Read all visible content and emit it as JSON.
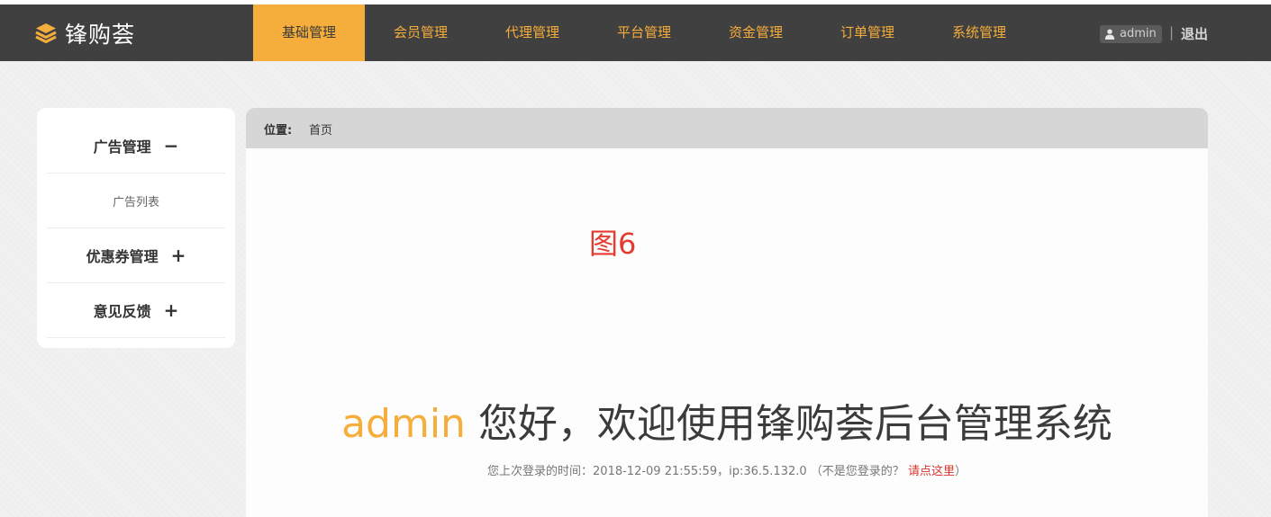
{
  "app": {
    "logo_text": "锋购荟"
  },
  "nav": {
    "items": [
      {
        "label": "基础管理",
        "active": true
      },
      {
        "label": "会员管理"
      },
      {
        "label": "代理管理"
      },
      {
        "label": "平台管理"
      },
      {
        "label": "资金管理"
      },
      {
        "label": "订单管理"
      },
      {
        "label": "系统管理"
      }
    ]
  },
  "user": {
    "name": "admin",
    "separator": "|",
    "logout_label": "退出"
  },
  "sidebar": {
    "groups": [
      {
        "title": "广告管理",
        "toggle": "−",
        "expanded": true,
        "items": [
          "广告列表"
        ]
      },
      {
        "title": "优惠券管理",
        "toggle": "+",
        "expanded": false
      },
      {
        "title": "意见反馈",
        "toggle": "+",
        "expanded": false
      }
    ]
  },
  "breadcrumb": {
    "label": "位置:",
    "items": [
      "首页"
    ]
  },
  "annotation": {
    "text": "图6"
  },
  "welcome": {
    "user": "admin",
    "message": "您好，欢迎使用锋购荟后台管理系统"
  },
  "login_info": {
    "prefix": "您上次登录的时间：",
    "time": "2018-12-09 21:55:59",
    "ip_part": "，ip:36.5.132.0",
    "question": "（不是您登录的？",
    "link": "请点这里",
    "suffix": "）"
  },
  "colors": {
    "accent": "#f5ad3c",
    "navbar_bg": "#404040",
    "link_red": "#d9352b",
    "annotation_red": "#e53b2e"
  },
  "icons": {
    "logo": "stacked-layers-icon",
    "user": "user-icon"
  }
}
